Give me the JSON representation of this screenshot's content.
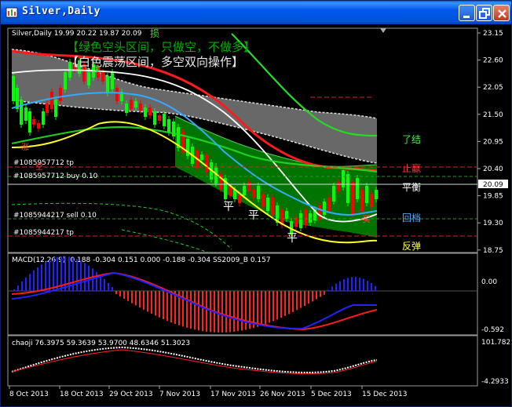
{
  "window": {
    "title": "Silver,Daily"
  },
  "main_chart": {
    "symbol_info": "Silver,Daily  19.99 20.22 19.87 20.09",
    "sun_label": "损",
    "banner_line1": "【绿色空头区间，只做空，不做多】",
    "banner_line2": "【白色震荡区间，多空双向操作】",
    "price_ticks": [
      "23.15",
      "22.60",
      "22.05",
      "21.50",
      "20.95",
      "20.40",
      "19.85",
      "19.30",
      "18.75"
    ],
    "current_price": "20.09",
    "orders": [
      {
        "label": "#1085957712 tp"
      },
      {
        "label": "#1085957712 buy 0.10"
      },
      {
        "label": "#1085944217 sell 0.10"
      },
      {
        "label": "#1085944217 tp"
      }
    ],
    "right_labels": {
      "liaojie": "了结",
      "zhiying": "止赢",
      "pingheng": "平衡",
      "huidang": "回档",
      "fantan": "反弹"
    },
    "candle_marks": {
      "ping1": "平",
      "ping2": "平",
      "ping3": "平",
      "mai": "买",
      "qiang": "强",
      "zhang": "涨",
      "kong": "空"
    },
    "colors": {
      "bull_candle": "#00ff00",
      "bear_candle": "#ff0000",
      "green_zone": "#007a00",
      "gray_band": "#808080",
      "white_line": "#ffffff",
      "red_line": "#ff1a1a",
      "green_line": "#22dd22",
      "blue_line": "#33aaff",
      "yellow_line": "#ffff22"
    }
  },
  "macd_panel": {
    "header": "MACD(12,26,9) -0.188 -0.304 0.151 0.000 -0.188 -0.304  SS2009_B 0.157",
    "ticks": [
      "0.00",
      "-0.592"
    ]
  },
  "chaoji_panel": {
    "header": "chaoji 76.3975 59.3639 53.9700 48.6346 51.3023",
    "ticks": [
      "101.7827",
      "-4.2933"
    ]
  },
  "time_axis": {
    "labels": [
      "8 Oct 2013",
      "18 Oct 2013",
      "29 Oct 2013",
      "7 Nov 2013",
      "17 Nov 2013",
      "26 Nov 2013",
      "5 Dec 2013",
      "15 Dec 2013"
    ]
  }
}
